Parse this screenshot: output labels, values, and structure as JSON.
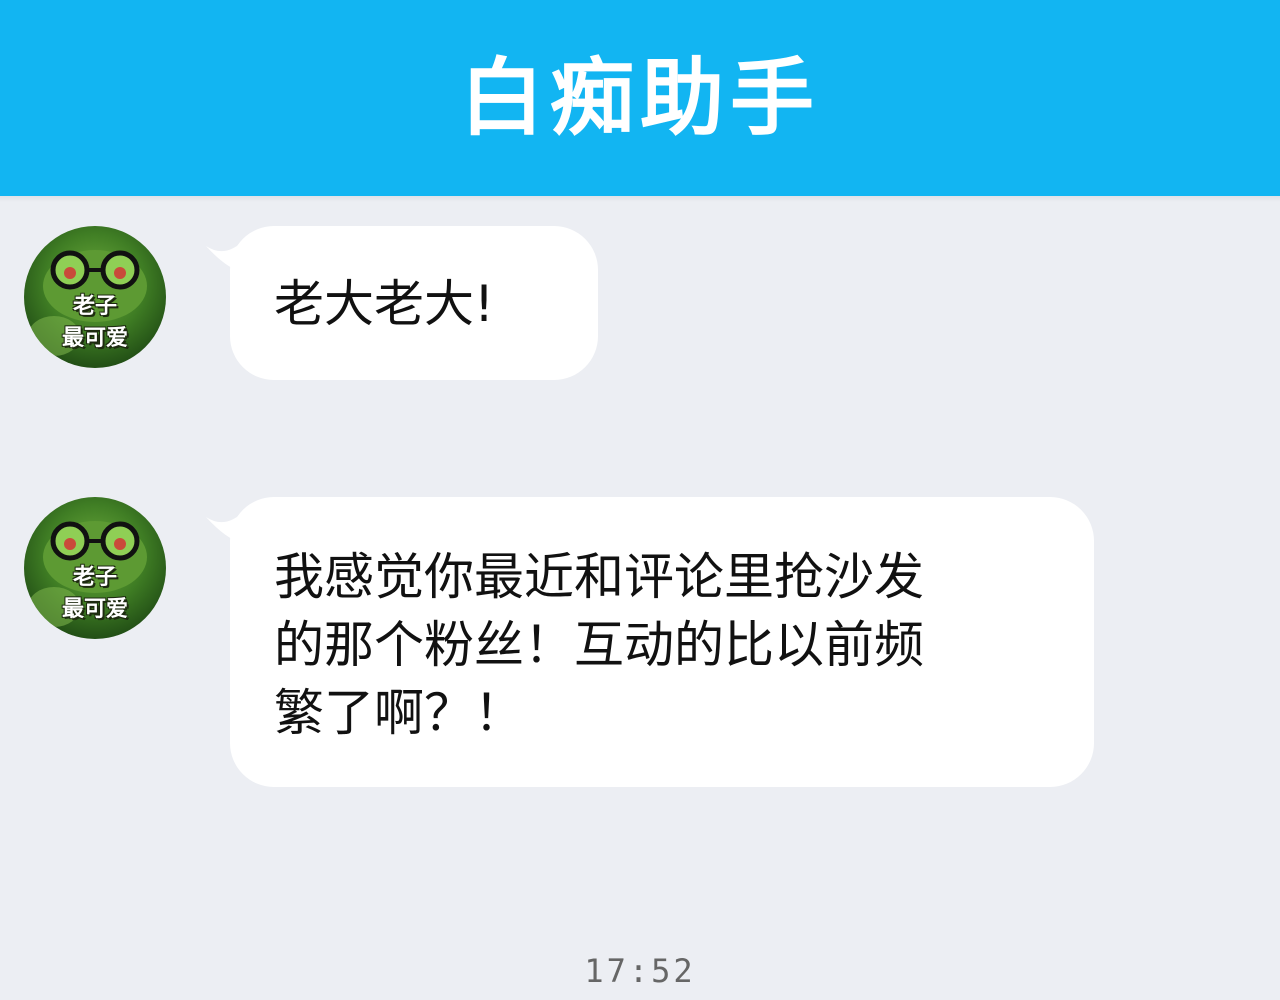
{
  "header": {
    "title": "白痴助手"
  },
  "messages": [
    {
      "avatar_text_line1": "老子",
      "avatar_text_line2": "最可爱",
      "text": "老大老大!"
    },
    {
      "avatar_text_line1": "老子",
      "avatar_text_line2": "最可爱",
      "lines": [
        "我感觉你最近和评论里抢沙发",
        "的那个粉丝！互动的比以前频",
        "繁了啊？！"
      ]
    }
  ],
  "timestamp": "17:52",
  "colors": {
    "header_bg": "#12b5f2",
    "chat_bg": "#eceef3",
    "bubble_bg": "#ffffff"
  },
  "icons": {
    "avatar": "frog-with-glasses-avatar-icon"
  }
}
